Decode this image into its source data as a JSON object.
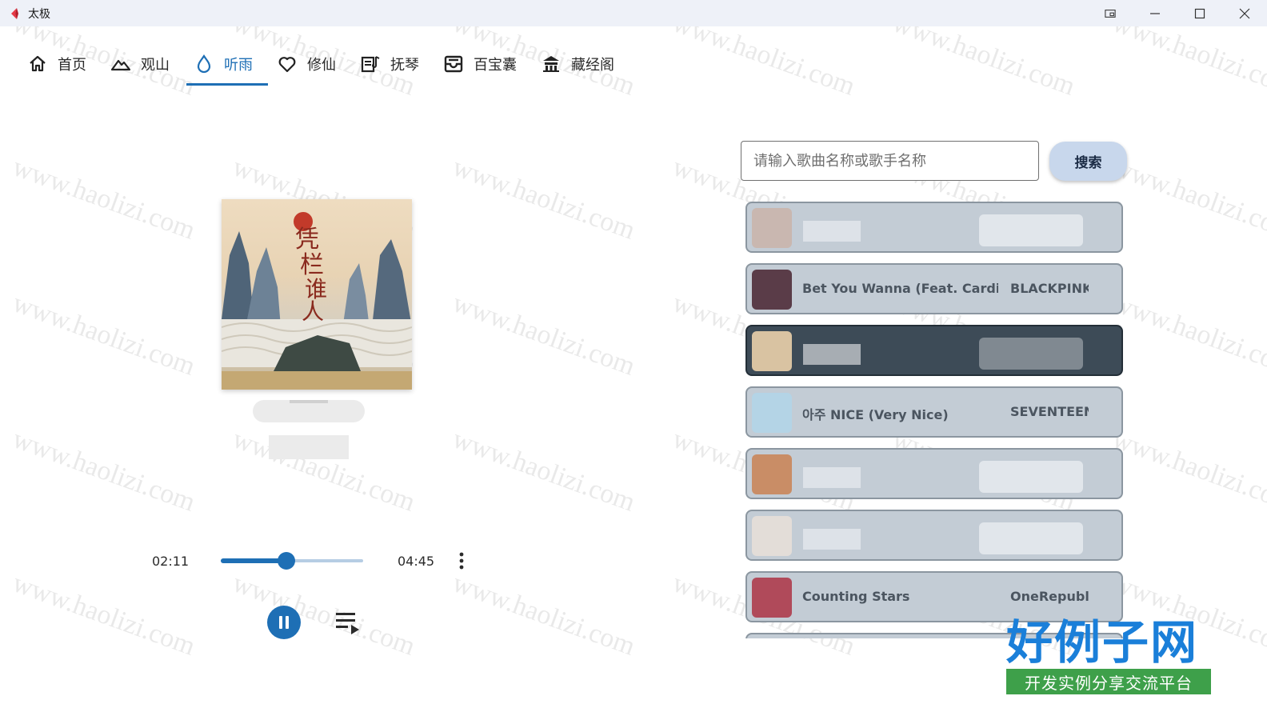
{
  "window": {
    "title": "太极",
    "accent": "#1e6fb5"
  },
  "nav": [
    {
      "label": "首页",
      "icon": "home-icon"
    },
    {
      "label": "观山",
      "icon": "mountain-icon"
    },
    {
      "label": "听雨",
      "icon": "water-drop-icon",
      "active": true
    },
    {
      "label": "修仙",
      "icon": "heart-icon"
    },
    {
      "label": "抚琴",
      "icon": "lyrics-icon"
    },
    {
      "label": "百宝囊",
      "icon": "inbox-icon"
    },
    {
      "label": "藏经阁",
      "icon": "temple-icon"
    }
  ],
  "player": {
    "current_time": "02:11",
    "total_time": "04:45",
    "progress": 0.46,
    "state": "playing"
  },
  "search": {
    "placeholder": "请输入歌曲名称或歌手名称",
    "button_label": "搜索"
  },
  "songs": [
    {
      "title": "",
      "artist": "",
      "blurred": true,
      "selected": false,
      "thumb_color": "#c9b7b0"
    },
    {
      "title": "Bet You Wanna (Feat. Cardi B",
      "artist": "BLACKPINK",
      "blurred": false,
      "selected": false,
      "thumb_color": "#5a3c48"
    },
    {
      "title": "",
      "artist": "",
      "blurred": true,
      "selected": true,
      "thumb_color": "#d9c3a2"
    },
    {
      "title": "아주 NICE (Very Nice)",
      "artist": "SEVENTEEN",
      "blurred": false,
      "selected": false,
      "thumb_color": "#b4d4e6"
    },
    {
      "title": "",
      "artist": "",
      "blurred": true,
      "selected": false,
      "thumb_color": "#c98d66"
    },
    {
      "title": "",
      "artist": "",
      "blurred": true,
      "selected": false,
      "thumb_color": "#e3ddd8"
    },
    {
      "title": "Counting Stars",
      "artist": "OneRepubli",
      "blurred": false,
      "selected": false,
      "thumb_color": "#b04a5a"
    }
  ],
  "watermark": {
    "text": "www.haolizi.com",
    "brand_main": "好例子网",
    "brand_sub": "开发实例分享交流平台"
  }
}
